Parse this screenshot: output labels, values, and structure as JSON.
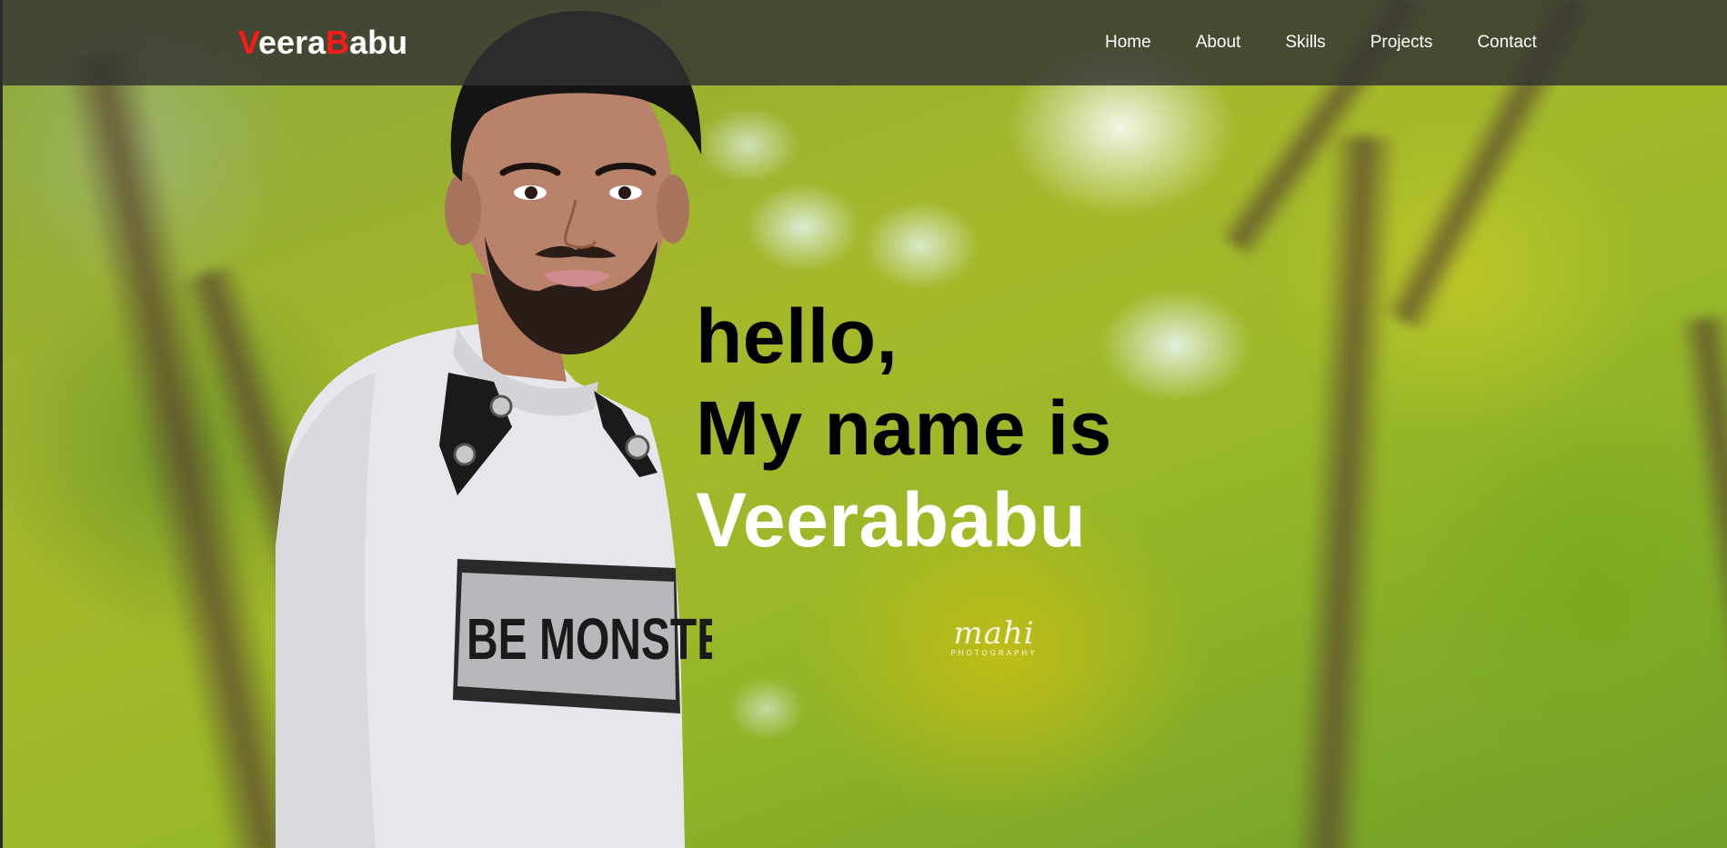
{
  "navbar": {
    "logo": {
      "first_initial": "V",
      "first_rest": "eera",
      "second_initial": "B",
      "second_rest": "abu"
    },
    "links": [
      "Home",
      "About",
      "Skills",
      "Projects",
      "Contact"
    ]
  },
  "hero": {
    "line1": "hello,",
    "line2": "My name is",
    "line3": "Veerababu"
  },
  "watermark": {
    "script": "mahi",
    "sub": "PHOTOGRAPHY"
  },
  "colors": {
    "accent": "#ff1a1a",
    "navbar_bg": "#323232",
    "text_dark": "#000000",
    "text_light": "#ffffff"
  }
}
